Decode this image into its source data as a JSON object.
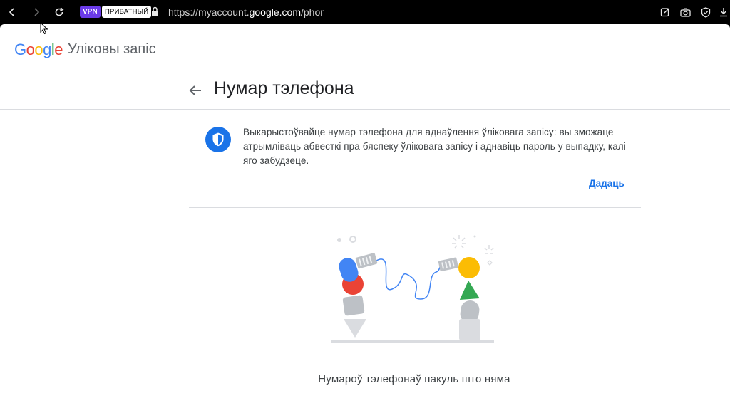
{
  "browser": {
    "vpn_label": "VPN",
    "private_label": "ПРИВАТНЫЙ",
    "url_prefix": "https://myaccount.",
    "url_domain": "google.com",
    "url_suffix": "/phone?"
  },
  "header": {
    "logo_text": "Google",
    "account_title": "Уліковы запіс"
  },
  "page": {
    "title": "Нумар тэлефона"
  },
  "info": {
    "text": "Выкарыстоўвайце нумар тэлефона для аднаўлення ўліковага запісу: вы зможаце атрымліваць абвесткі пра бяспеку ўліковага запісу і аднавіць пароль у выпадку, калі яго забудзеце.",
    "add_label": "Дадаць"
  },
  "empty_state": {
    "message": "Нумароў тэлефонаў пакуль што няма"
  },
  "colors": {
    "accent": "#1a73e8",
    "google_blue": "#4285f4",
    "google_red": "#ea4335",
    "google_yellow": "#fbbc04",
    "google_green": "#34a853"
  }
}
